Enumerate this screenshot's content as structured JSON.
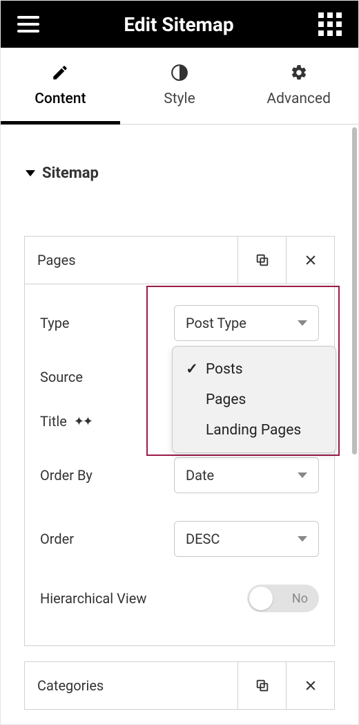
{
  "header": {
    "title": "Edit Sitemap"
  },
  "tabs": {
    "content": "Content",
    "style": "Style",
    "advanced": "Advanced"
  },
  "section": {
    "title": "Sitemap"
  },
  "items": {
    "pages": {
      "title": "Pages",
      "controls": {
        "type_label": "Type",
        "type_value": "Post Type",
        "source_label": "Source",
        "source_options": {
          "posts": "Posts",
          "pages": "Pages",
          "landing_pages": "Landing Pages"
        },
        "source_selected": "Posts",
        "title_label": "Title",
        "orderby_label": "Order By",
        "orderby_value": "Date",
        "order_label": "Order",
        "order_value": "DESC",
        "hierarchical_label": "Hierarchical View",
        "hierarchical_value": "No"
      }
    },
    "categories": {
      "title": "Categories"
    }
  }
}
